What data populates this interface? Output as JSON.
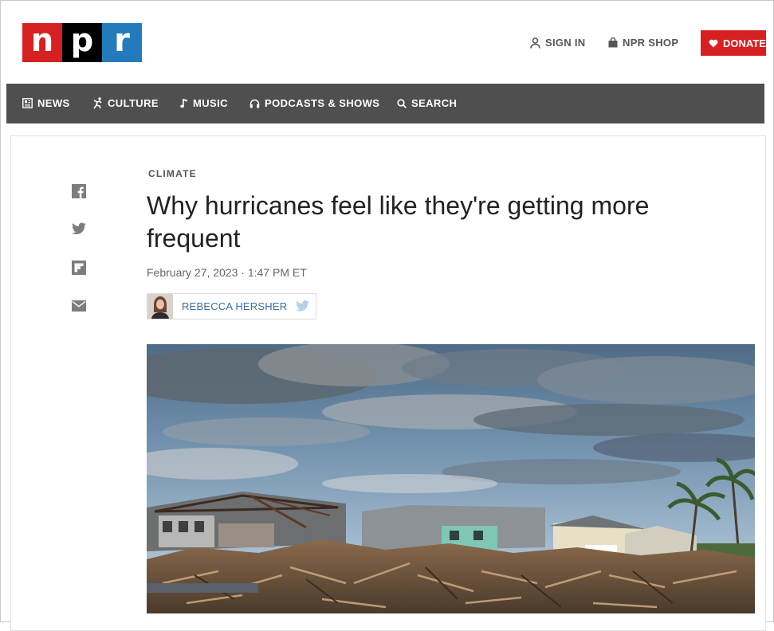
{
  "logo": {
    "letters": [
      "n",
      "p",
      "r"
    ]
  },
  "header": {
    "sign_in": "SIGN IN",
    "shop": "NPR SHOP",
    "donate": "DONATE"
  },
  "nav": {
    "items": [
      {
        "label": "NEWS",
        "icon": "newspaper-icon"
      },
      {
        "label": "CULTURE",
        "icon": "figure-icon"
      },
      {
        "label": "MUSIC",
        "icon": "music-note-icon"
      },
      {
        "label": "PODCASTS & SHOWS",
        "icon": "headphones-icon"
      },
      {
        "label": "SEARCH",
        "icon": "search-icon"
      }
    ]
  },
  "share": [
    "facebook-icon",
    "twitter-icon",
    "flipboard-icon",
    "email-icon"
  ],
  "article": {
    "slug": "CLIMATE",
    "title": "Why hurricanes feel like they're getting more frequent",
    "date": "February 27, 2023 · 1:47 PM ET",
    "author": "REBECCA HERSHER"
  },
  "colors": {
    "npr_red": "#d62021",
    "npr_black": "#000000",
    "npr_blue": "#237bbd",
    "nav_bg": "#4f4f4f",
    "link_blue": "#3a6ea5"
  }
}
